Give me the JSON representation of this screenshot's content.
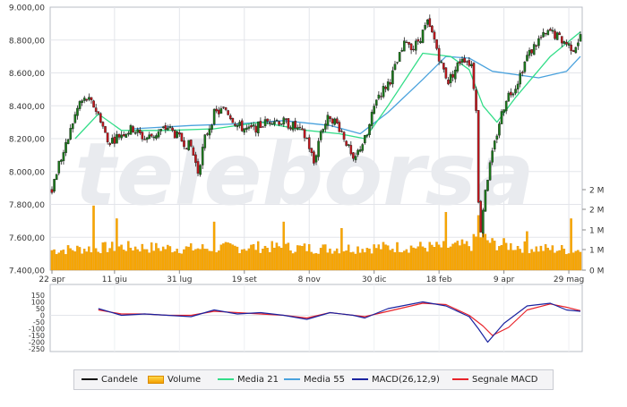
{
  "chart_data": [
    {
      "type": "candlestick",
      "panel": "price",
      "watermark": "teleborsa",
      "x_tick_labels": [
        "22 apr",
        "11 giu",
        "31 lug",
        "19 set",
        "8 nov",
        "30 dic",
        "18 feb",
        "9 apr",
        "29 mag"
      ],
      "y_tick_labels": [
        "9.000,00",
        "8.800,00",
        "8.600,00",
        "8.400,00",
        "8.200,00",
        "8.000,00",
        "7.800,00",
        "7.600,00",
        "7.400,00"
      ],
      "ylim": [
        7400,
        9000
      ],
      "volume_axis_labels": [
        "2 M",
        "2 M",
        "1 M",
        "1 M",
        "0 M"
      ],
      "volume_ylim": [
        0,
        2500000
      ],
      "close_path": [
        [
          0,
          7900
        ],
        [
          3,
          8050
        ],
        [
          6,
          8150
        ],
        [
          9,
          8300
        ],
        [
          12,
          8420
        ],
        [
          15,
          8440
        ],
        [
          18,
          8400
        ],
        [
          21,
          8320
        ],
        [
          24,
          8180
        ],
        [
          27,
          8200
        ],
        [
          30,
          8230
        ],
        [
          35,
          8260
        ],
        [
          40,
          8200
        ],
        [
          45,
          8230
        ],
        [
          50,
          8270
        ],
        [
          55,
          8200
        ],
        [
          60,
          8150
        ],
        [
          63,
          8000
        ],
        [
          66,
          8200
        ],
        [
          70,
          8350
        ],
        [
          75,
          8380
        ],
        [
          80,
          8280
        ],
        [
          85,
          8250
        ],
        [
          90,
          8280
        ],
        [
          95,
          8320
        ],
        [
          100,
          8300
        ],
        [
          105,
          8270
        ],
        [
          110,
          8200
        ],
        [
          113,
          8050
        ],
        [
          116,
          8250
        ],
        [
          120,
          8340
        ],
        [
          124,
          8270
        ],
        [
          127,
          8180
        ],
        [
          130,
          8050
        ],
        [
          133,
          8150
        ],
        [
          136,
          8220
        ],
        [
          140,
          8450
        ],
        [
          143,
          8500
        ],
        [
          146,
          8560
        ],
        [
          150,
          8700
        ],
        [
          153,
          8800
        ],
        [
          156,
          8750
        ],
        [
          159,
          8820
        ],
        [
          162,
          8900
        ],
        [
          165,
          8800
        ],
        [
          168,
          8650
        ],
        [
          171,
          8550
        ],
        [
          174,
          8620
        ],
        [
          177,
          8700
        ],
        [
          181,
          8650
        ],
        [
          183,
          8400
        ],
        [
          184,
          7800
        ],
        [
          185,
          7650
        ],
        [
          187,
          7900
        ],
        [
          190,
          8100
        ],
        [
          193,
          8300
        ],
        [
          196,
          8450
        ],
        [
          200,
          8520
        ],
        [
          205,
          8700
        ],
        [
          210,
          8800
        ],
        [
          215,
          8850
        ],
        [
          220,
          8800
        ],
        [
          225,
          8750
        ],
        [
          228,
          8820
        ]
      ],
      "volume_path": [
        [
          0,
          600000
        ],
        [
          30,
          700000
        ],
        [
          60,
          650000
        ],
        [
          90,
          700000
        ],
        [
          120,
          650000
        ],
        [
          150,
          700000
        ],
        [
          170,
          700000
        ],
        [
          181,
          750000
        ],
        [
          184,
          1100000
        ],
        [
          190,
          800000
        ],
        [
          210,
          650000
        ],
        [
          228,
          600000
        ]
      ],
      "volume_spikes": [
        [
          18,
          2000000
        ],
        [
          28,
          1600000
        ],
        [
          70,
          1500000
        ],
        [
          100,
          1500000
        ],
        [
          125,
          1300000
        ],
        [
          170,
          1800000
        ],
        [
          184,
          1700000
        ],
        [
          205,
          1200000
        ],
        [
          224,
          1600000
        ]
      ],
      "series": [
        {
          "name": "Media 21",
          "color": "#33dd88",
          "values": [
            [
              10,
              8200
            ],
            [
              20,
              8350
            ],
            [
              30,
              8250
            ],
            [
              50,
              8250
            ],
            [
              70,
              8260
            ],
            [
              90,
              8300
            ],
            [
              110,
              8250
            ],
            [
              124,
              8230
            ],
            [
              135,
              8200
            ],
            [
              145,
              8400
            ],
            [
              160,
              8720
            ],
            [
              172,
              8700
            ],
            [
              180,
              8620
            ],
            [
              186,
              8400
            ],
            [
              192,
              8300
            ],
            [
              200,
              8450
            ],
            [
              215,
              8700
            ],
            [
              228,
              8850
            ]
          ]
        },
        {
          "name": "Media 55",
          "color": "#4aa2dd",
          "values": [
            [
              35,
              8260
            ],
            [
              60,
              8280
            ],
            [
              80,
              8290
            ],
            [
              100,
              8310
            ],
            [
              120,
              8280
            ],
            [
              133,
              8230
            ],
            [
              145,
              8360
            ],
            [
              160,
              8560
            ],
            [
              170,
              8700
            ],
            [
              180,
              8690
            ],
            [
              190,
              8610
            ],
            [
              210,
              8570
            ],
            [
              222,
              8610
            ],
            [
              228,
              8700
            ]
          ]
        }
      ]
    },
    {
      "type": "line",
      "panel": "macd",
      "y_tick_labels": [
        "150",
        "100",
        "50",
        "0",
        "-50",
        "-100",
        "-150",
        "-200",
        "-250"
      ],
      "ylim": [
        -250,
        150
      ],
      "series": [
        {
          "name": "MACD(26,12,9)",
          "color": "#1a23a0",
          "values": [
            [
              20,
              50
            ],
            [
              30,
              0
            ],
            [
              40,
              10
            ],
            [
              50,
              0
            ],
            [
              60,
              -10
            ],
            [
              70,
              40
            ],
            [
              80,
              10
            ],
            [
              90,
              20
            ],
            [
              100,
              0
            ],
            [
              110,
              -30
            ],
            [
              120,
              20
            ],
            [
              130,
              0
            ],
            [
              135,
              -20
            ],
            [
              145,
              50
            ],
            [
              160,
              100
            ],
            [
              170,
              70
            ],
            [
              180,
              -10
            ],
            [
              184,
              -100
            ],
            [
              188,
              -200
            ],
            [
              195,
              -60
            ],
            [
              205,
              70
            ],
            [
              215,
              90
            ],
            [
              222,
              40
            ],
            [
              228,
              30
            ]
          ]
        },
        {
          "name": "Segnale MACD",
          "color": "#e8232a",
          "values": [
            [
              20,
              40
            ],
            [
              30,
              10
            ],
            [
              40,
              10
            ],
            [
              50,
              0
            ],
            [
              60,
              0
            ],
            [
              70,
              30
            ],
            [
              80,
              20
            ],
            [
              90,
              10
            ],
            [
              100,
              0
            ],
            [
              110,
              -20
            ],
            [
              120,
              20
            ],
            [
              130,
              0
            ],
            [
              135,
              -10
            ],
            [
              145,
              30
            ],
            [
              160,
              90
            ],
            [
              170,
              80
            ],
            [
              180,
              0
            ],
            [
              186,
              -80
            ],
            [
              190,
              -150
            ],
            [
              197,
              -90
            ],
            [
              205,
              40
            ],
            [
              215,
              85
            ],
            [
              222,
              60
            ],
            [
              228,
              35
            ]
          ]
        }
      ]
    }
  ],
  "legend": [
    {
      "label": "Candele",
      "swatch": "line",
      "color": "#111111"
    },
    {
      "label": "Volume",
      "swatch": "bar",
      "color": "#f5a100"
    },
    {
      "label": "Media 21",
      "swatch": "line",
      "color": "#33dd88"
    },
    {
      "label": "Media 55",
      "swatch": "line",
      "color": "#4aa2dd"
    },
    {
      "label": "MACD(26,12,9)",
      "swatch": "line",
      "color": "#1a23a0"
    },
    {
      "label": "Segnale MACD",
      "swatch": "line",
      "color": "#e8232a"
    }
  ]
}
